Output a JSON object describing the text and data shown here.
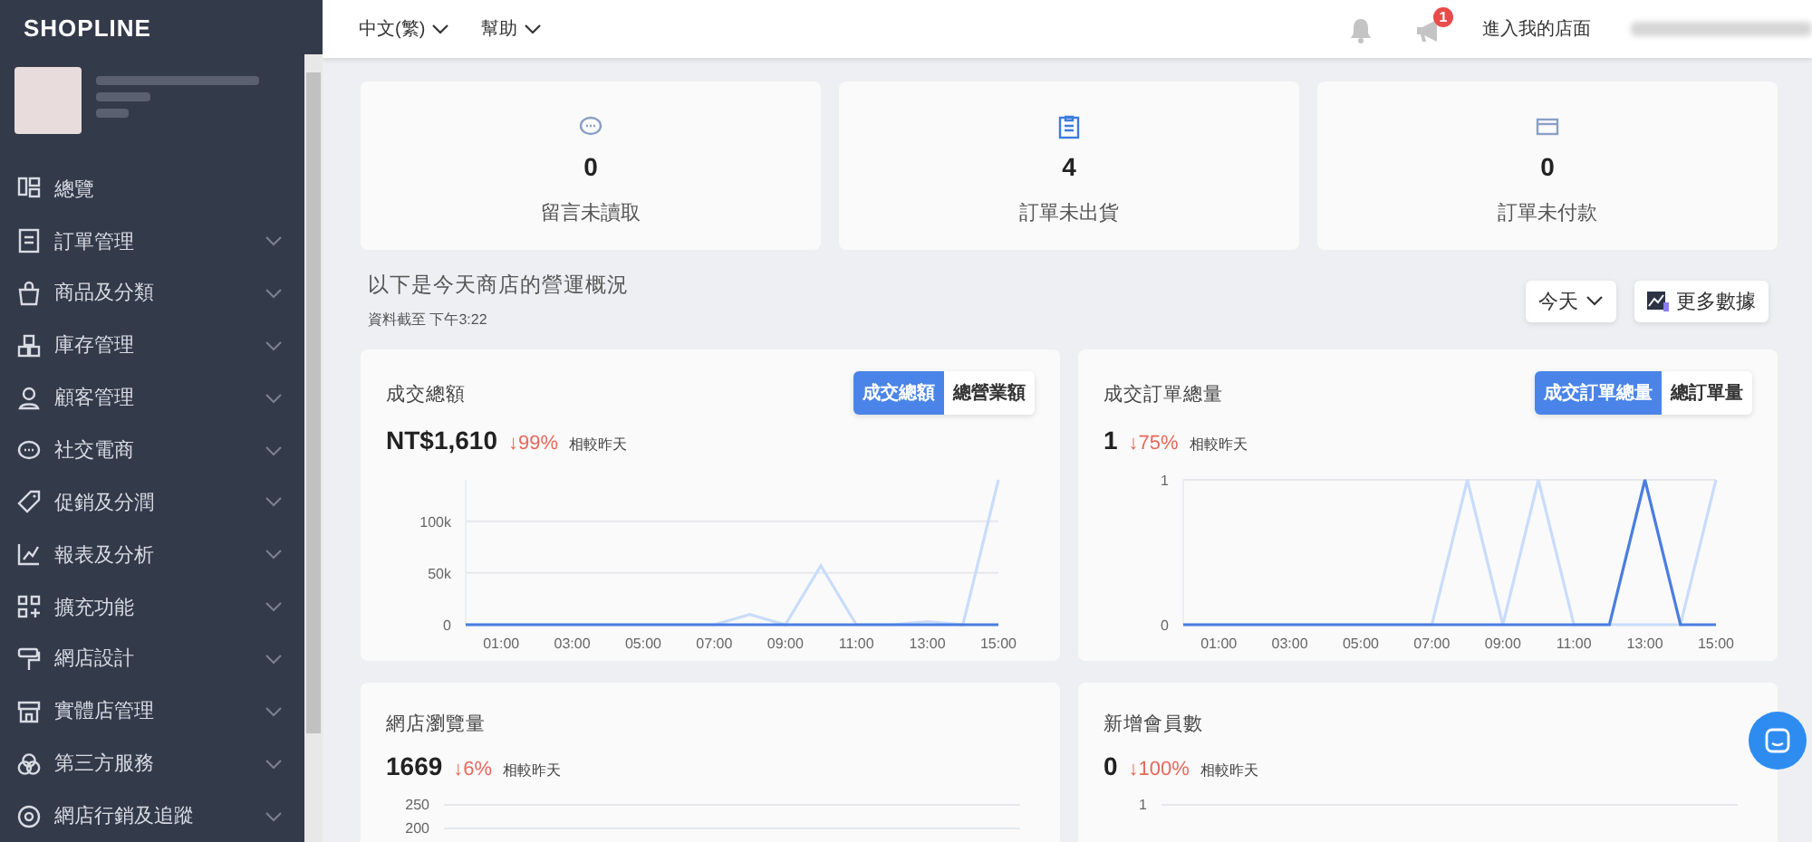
{
  "sidebar": {
    "logo": "SHOPLINE",
    "items": [
      {
        "label": "總覽",
        "expandable": false
      },
      {
        "label": "訂單管理",
        "expandable": true
      },
      {
        "label": "商品及分類",
        "expandable": true
      },
      {
        "label": "庫存管理",
        "expandable": true
      },
      {
        "label": "顧客管理",
        "expandable": true
      },
      {
        "label": "社交電商",
        "expandable": true
      },
      {
        "label": "促銷及分潤",
        "expandable": true
      },
      {
        "label": "報表及分析",
        "expandable": true
      },
      {
        "label": "擴充功能",
        "expandable": true
      },
      {
        "label": "網店設計",
        "expandable": true
      },
      {
        "label": "實體店管理",
        "expandable": true
      },
      {
        "label": "第三方服務",
        "expandable": true
      },
      {
        "label": "網店行銷及追蹤",
        "expandable": true
      }
    ]
  },
  "top_bar": {
    "menus": [
      "中文(繁)",
      "幫助"
    ],
    "notification_badge": "1",
    "storefront_link": "進入我的店面"
  },
  "stats": [
    {
      "value": "0",
      "label": "留言未讀取"
    },
    {
      "value": "4",
      "label": "訂單未出貨"
    },
    {
      "value": "0",
      "label": "訂單未付款"
    }
  ],
  "overview": {
    "title": "以下是今天商店的營運概況",
    "updated": "資料截至 下午3:22",
    "period": "今天",
    "more_button": "更多數據"
  },
  "charts": [
    {
      "title": "成交總額",
      "value": "NT$1,610",
      "change": "↓99%",
      "compare": "相較昨天",
      "toggles": [
        {
          "label": "成交總額",
          "selected": true
        },
        {
          "label": "總營業額",
          "selected": false
        }
      ],
      "chart_data": {
        "type": "line",
        "x": [
          0,
          1,
          2,
          3,
          4,
          5,
          6,
          7,
          8,
          9,
          10,
          11,
          12,
          13,
          14,
          15
        ],
        "xlim": [
          0,
          15
        ],
        "ylim": [
          0,
          140000
        ],
        "yticks": [
          {
            "value": 0,
            "label": "0"
          },
          {
            "value": 50000,
            "label": "50k"
          },
          {
            "value": 100000,
            "label": "100k"
          }
        ],
        "xticks": [
          {
            "value": 1,
            "label": "01:00"
          },
          {
            "value": 3,
            "label": "03:00"
          },
          {
            "value": 5,
            "label": "05:00"
          },
          {
            "value": 7,
            "label": "07:00"
          },
          {
            "value": 9,
            "label": "09:00"
          },
          {
            "value": 11,
            "label": "11:00"
          },
          {
            "value": 13,
            "label": "13:00"
          },
          {
            "value": 15,
            "label": "15:00"
          }
        ],
        "series": [
          {
            "color": "#c9dcfb",
            "values": [
              0,
              0,
              0,
              0,
              0,
              0,
              0,
              0,
              10000,
              0,
              57000,
              0,
              0,
              3000,
              0,
              140000
            ]
          },
          {
            "color": "#4a7ee0",
            "values": [
              0,
              0,
              0,
              0,
              0,
              0,
              0,
              0,
              0,
              0,
              0,
              0,
              0,
              0,
              0,
              0
            ]
          }
        ]
      }
    },
    {
      "title": "成交訂單總量",
      "value": "1",
      "change": "↓75%",
      "compare": "相較昨天",
      "toggles": [
        {
          "label": "成交訂單總量",
          "selected": true
        },
        {
          "label": "總訂單量",
          "selected": false
        }
      ],
      "chart_data": {
        "type": "line",
        "x": [
          0,
          1,
          2,
          3,
          4,
          5,
          6,
          7,
          8,
          9,
          10,
          11,
          12,
          13,
          14,
          15
        ],
        "xlim": [
          0,
          15
        ],
        "ylim": [
          0,
          1
        ],
        "yticks": [
          0,
          1
        ],
        "xticks": [
          {
            "value": 1,
            "label": "01:00"
          },
          {
            "value": 3,
            "label": "03:00"
          },
          {
            "value": 5,
            "label": "05:00"
          },
          {
            "value": 7,
            "label": "07:00"
          },
          {
            "value": 9,
            "label": "09:00"
          },
          {
            "value": 11,
            "label": "11:00"
          },
          {
            "value": 13,
            "label": "13:00"
          },
          {
            "value": 15,
            "label": "15:00"
          }
        ],
        "series": [
          {
            "color": "#c9dcfb",
            "values": [
              0,
              0,
              0,
              0,
              0,
              0,
              0,
              0,
              1,
              0,
              1,
              0,
              0,
              0,
              0,
              1
            ]
          },
          {
            "color": "#4a7ee0",
            "values": [
              0,
              0,
              0,
              0,
              0,
              0,
              0,
              0,
              0,
              0,
              0,
              0,
              0,
              1,
              0,
              0
            ]
          }
        ]
      }
    }
  ],
  "bottom_cards": [
    {
      "title": "網店瀏覽量",
      "value": "1669",
      "change": "↓6%",
      "compare": "相較昨天",
      "axis_labels": [
        "250",
        "200"
      ]
    },
    {
      "title": "新增會員數",
      "value": "0",
      "change": "↓100%",
      "compare": "相較昨天",
      "axis_labels": [
        "1"
      ]
    }
  ]
}
